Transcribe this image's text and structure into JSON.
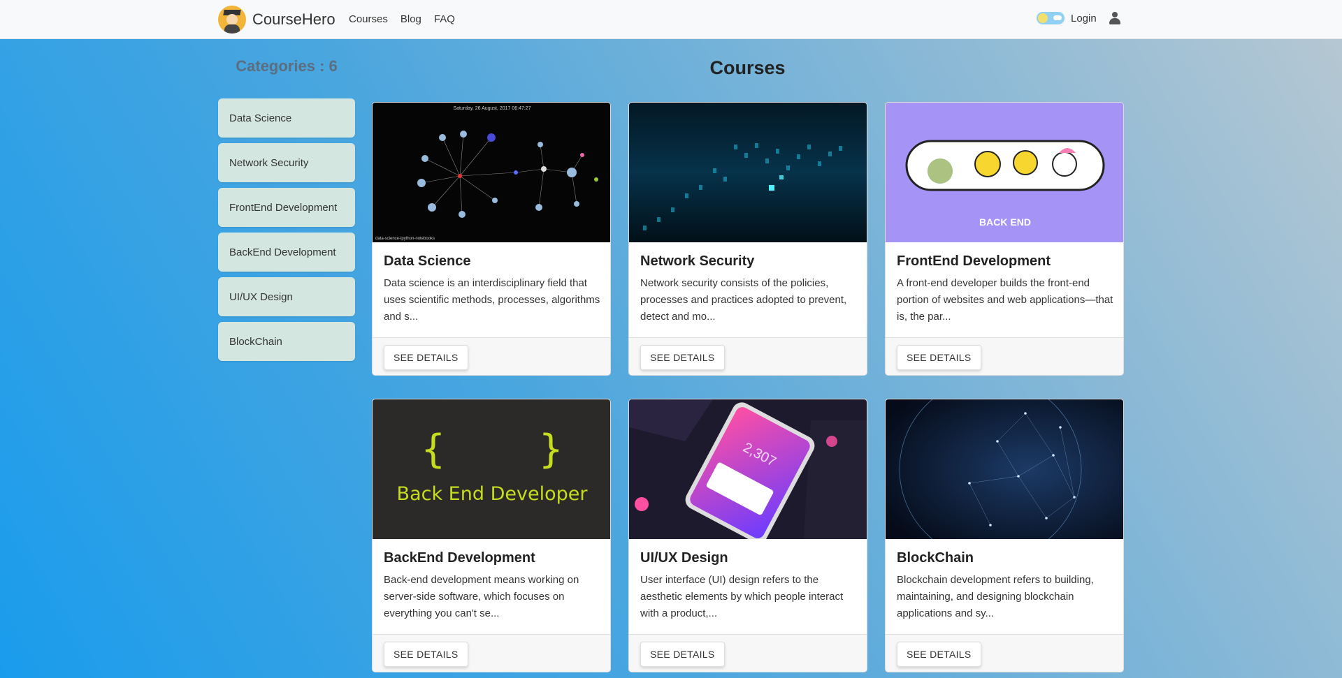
{
  "brand": {
    "name": "CourseHero"
  },
  "nav": {
    "links": [
      "Courses",
      "Blog",
      "FAQ"
    ],
    "login": "Login"
  },
  "sidebar": {
    "title": "Categories : 6",
    "items": [
      "Data Science",
      "Network Security",
      "FrontEnd Development",
      "BackEnd Development",
      "UI/UX Design",
      "BlockChain"
    ]
  },
  "main": {
    "title": "Courses",
    "cards": [
      {
        "title": "Data Science",
        "text": "Data science is an interdisciplinary field that uses scientific methods, processes, algorithms and s...",
        "button": "SEE DETAILS",
        "image": {
          "caption_top": "Saturday, 26 August, 2017 06:47:27",
          "caption_bottom": "data-science-ipython-notebooks"
        }
      },
      {
        "title": "Network Security",
        "text": "Network security consists of the policies, processes and practices adopted to prevent, detect and mo...",
        "button": "SEE DETAILS"
      },
      {
        "title": "FrontEnd Development",
        "text": "A front-end developer builds the front-end portion of websites and web applications—that is, the par...",
        "button": "SEE DETAILS",
        "image": {
          "label": "BACK END"
        }
      },
      {
        "title": "BackEnd Development",
        "text": "Back-end development means working on server-side software, which focuses on everything you can't se...",
        "button": "SEE DETAILS",
        "image": {
          "braces": "{    }",
          "label": "Back End Developer"
        }
      },
      {
        "title": "UI/UX Design",
        "text": "User interface (UI) design refers to the aesthetic elements by which people interact with a product,...",
        "button": "SEE DETAILS",
        "image": {
          "number": "2,307"
        }
      },
      {
        "title": "BlockChain",
        "text": "Blockchain development refers to building, maintaining, and designing blockchain applications and sy...",
        "button": "SEE DETAILS"
      }
    ]
  },
  "colors": {
    "category_bg": "#d4e6e0",
    "brand_logo": "#f3b43a"
  },
  "icons": [
    "graduate-avatar-icon",
    "theme-toggle-icon",
    "user-icon"
  ]
}
